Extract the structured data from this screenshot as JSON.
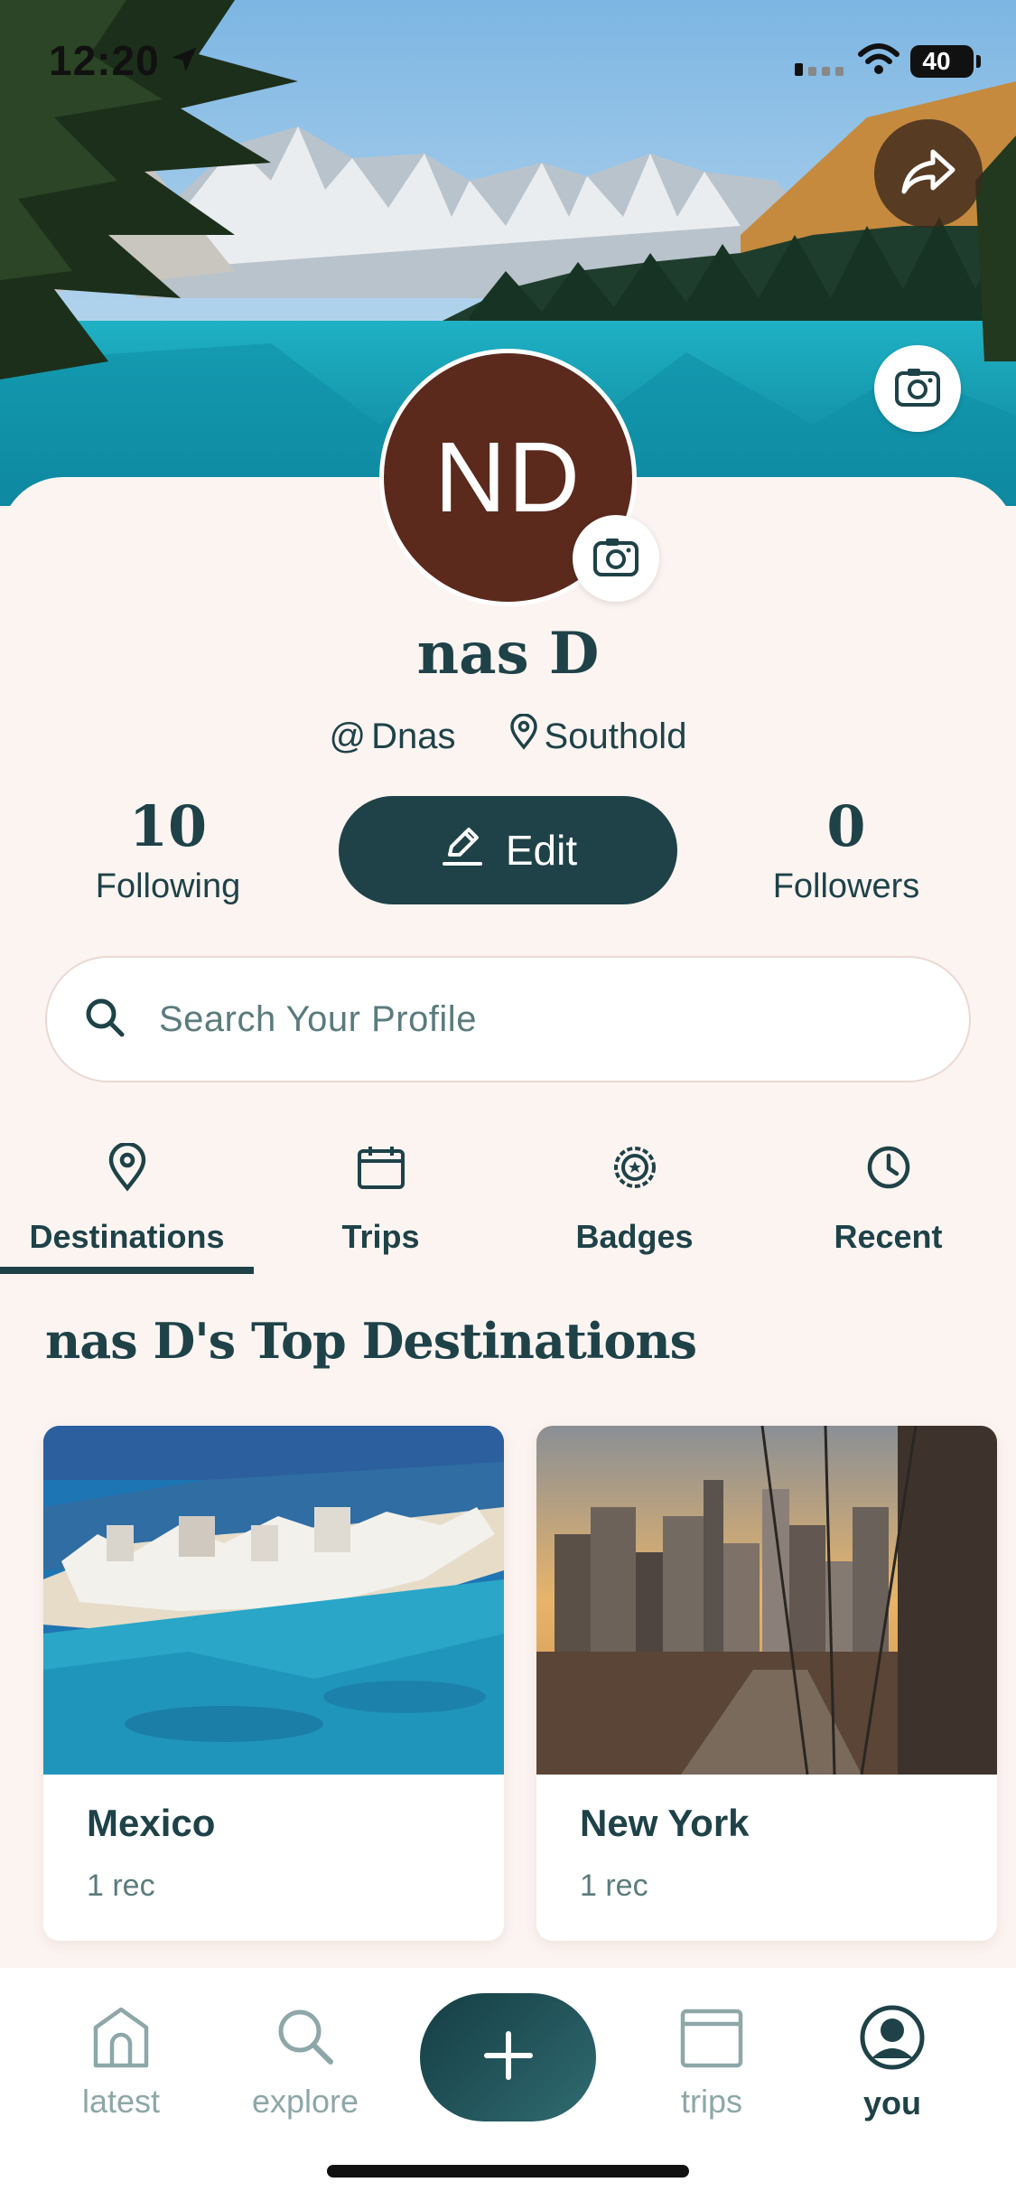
{
  "status_bar": {
    "time": "12:20",
    "battery": "40"
  },
  "profile": {
    "initials": "ND",
    "name": "nas D",
    "username": "Dnas",
    "location": "Southold",
    "following_count": "10",
    "following_label": "Following",
    "followers_count": "0",
    "followers_label": "Followers",
    "edit_label": "Edit"
  },
  "search": {
    "placeholder": "Search Your Profile"
  },
  "tabs": [
    {
      "label": "Destinations",
      "icon": "map-pin-icon",
      "active": true
    },
    {
      "label": "Trips",
      "icon": "calendar-icon",
      "active": false
    },
    {
      "label": "Badges",
      "icon": "badge-icon",
      "active": false
    },
    {
      "label": "Recent",
      "icon": "clock-icon",
      "active": false
    }
  ],
  "section": {
    "title": "nas D's Top Destinations"
  },
  "destinations": [
    {
      "name": "Mexico",
      "count": "1 rec"
    },
    {
      "name": "New York",
      "count": "1 rec"
    }
  ],
  "nav": [
    {
      "label": "latest",
      "icon": "home-icon",
      "active": false
    },
    {
      "label": "explore",
      "icon": "search-icon",
      "active": false
    },
    {
      "label": "add",
      "icon": "plus-icon",
      "active": false
    },
    {
      "label": "trips",
      "icon": "calendar-icon",
      "active": false
    },
    {
      "label": "you",
      "icon": "user-icon",
      "active": true
    }
  ],
  "colors": {
    "accent": "#1e4248",
    "background": "#fcf4f1",
    "avatar": "#5b2a1d",
    "muted": "#8ea7a8"
  }
}
